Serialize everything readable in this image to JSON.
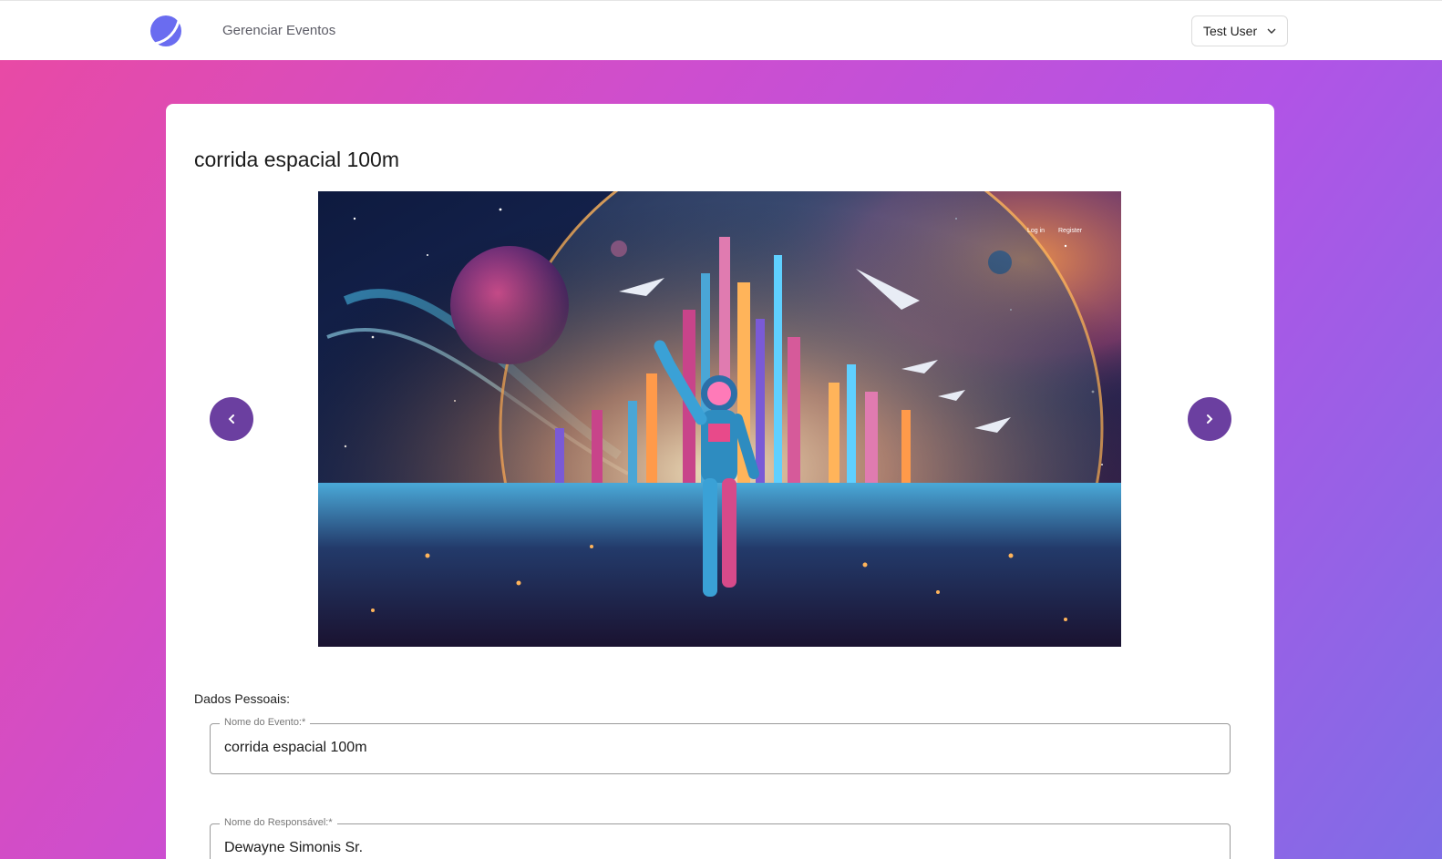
{
  "header": {
    "nav_link": "Gerenciar Eventos",
    "user_name": "Test User",
    "logo_icon": "moon-logo-icon"
  },
  "page": {
    "title": "corrida espacial 100m"
  },
  "carousel": {
    "image_overlay_links": [
      "Log in",
      "Register"
    ],
    "prev_icon": "chevron-left-icon",
    "next_icon": "chevron-right-icon",
    "button_color": "#6b3fa0"
  },
  "form": {
    "section_label": "Dados Pessoais:",
    "fields": [
      {
        "label": "Nome do Evento:*",
        "value": "corrida espacial 100m"
      },
      {
        "label": "Nome do Responsável:*",
        "value": "Dewayne Simonis Sr."
      }
    ]
  },
  "colors": {
    "gradient_start": "#e84aa5",
    "gradient_end": "#7f6de6",
    "logo": "#6a6cf0"
  }
}
